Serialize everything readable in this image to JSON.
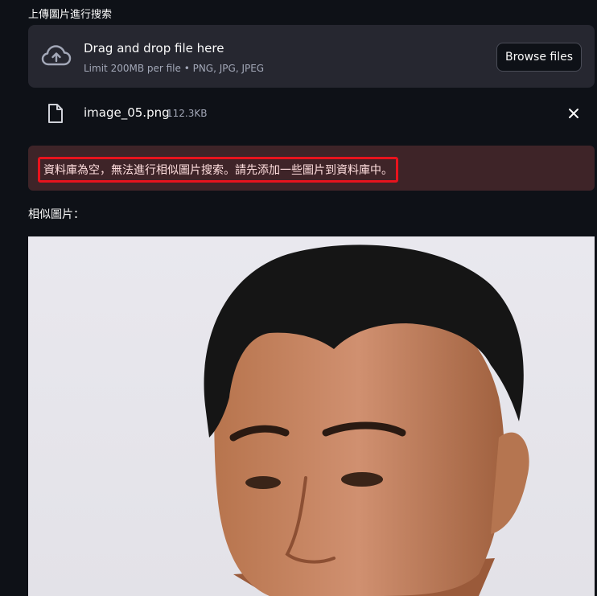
{
  "uploader": {
    "label": "上傳圖片進行搜索",
    "drop_title": "Drag and drop file here",
    "limit_text": "Limit 200MB per file • PNG, JPG, JPEG",
    "browse_label": "Browse files",
    "upload_icon": "cloud-upload-icon"
  },
  "uploaded_file": {
    "name": "image_05.png",
    "size": "112.3KB",
    "file_icon": "file-icon",
    "remove_icon": "close-icon"
  },
  "error": {
    "message": "資料庫為空，無法進行相似圖片搜索。請先添加一些圖片到資料庫中。",
    "highlight_color": "#e8131d"
  },
  "results": {
    "label": "相似圖片："
  },
  "colors": {
    "background": "#0e1117",
    "panel": "#262730",
    "error_bg": "#3e2428"
  }
}
